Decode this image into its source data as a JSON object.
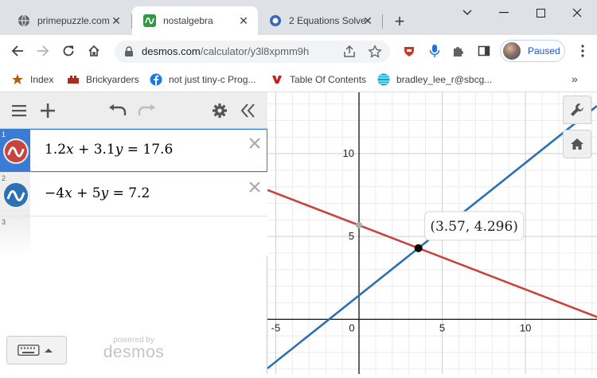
{
  "browser": {
    "tabs": [
      {
        "label": "primepuzzle.com",
        "icon": "globe-icon",
        "active": false
      },
      {
        "label": "nostalgebra",
        "icon": "desmos-favicon-icon",
        "active": true
      },
      {
        "label": "2 Equations Solve",
        "icon": "calculator-favicon-icon",
        "active": false
      }
    ],
    "url": {
      "host": "desmos.com",
      "path": "/calculator/y3l8xpmm9h"
    },
    "profile_label": "Paused",
    "bookmarks": [
      {
        "label": "Index",
        "icon": "index-icon"
      },
      {
        "label": "Brickyarders",
        "icon": "brick-icon"
      },
      {
        "label": "not just tiny-c Prog...",
        "icon": "facebook-icon"
      },
      {
        "label": "Table Of Contents",
        "icon": "toc-icon"
      },
      {
        "label": "bradley_lee_r@sbcg...",
        "icon": "att-icon"
      }
    ]
  },
  "desmos": {
    "expressions": [
      {
        "num": "1",
        "color": "#c74440",
        "math": {
          "a": "1.2",
          "v1": "x",
          "op": "+",
          "b": "3.1",
          "v2": "y",
          "eq": "=",
          "c": "17.6"
        },
        "coef": [
          1.2,
          3.1,
          17.6
        ]
      },
      {
        "num": "2",
        "color": "#2d70b3",
        "math": {
          "a": "−4",
          "v1": "x",
          "op": "+",
          "b": "5",
          "v2": "y",
          "eq": "=",
          "c": "7.2"
        },
        "coef": [
          -4,
          5,
          7.2
        ]
      },
      {
        "num": "3"
      }
    ],
    "powered_small": "powered by",
    "powered_big": "desmos",
    "graph": {
      "x_range": [
        -5.5,
        14.3
      ],
      "y_range": [
        -3.3,
        13.7
      ],
      "x_ticks": [
        "-5",
        "0",
        "5",
        "10"
      ],
      "y_ticks": [
        "5",
        "10"
      ],
      "intersection": {
        "x": 3.57,
        "y": 4.296
      },
      "intersection_label": "(3.57, 4.296)",
      "y_intercept_point": {
        "x": 0,
        "y": 5.677
      }
    }
  }
}
